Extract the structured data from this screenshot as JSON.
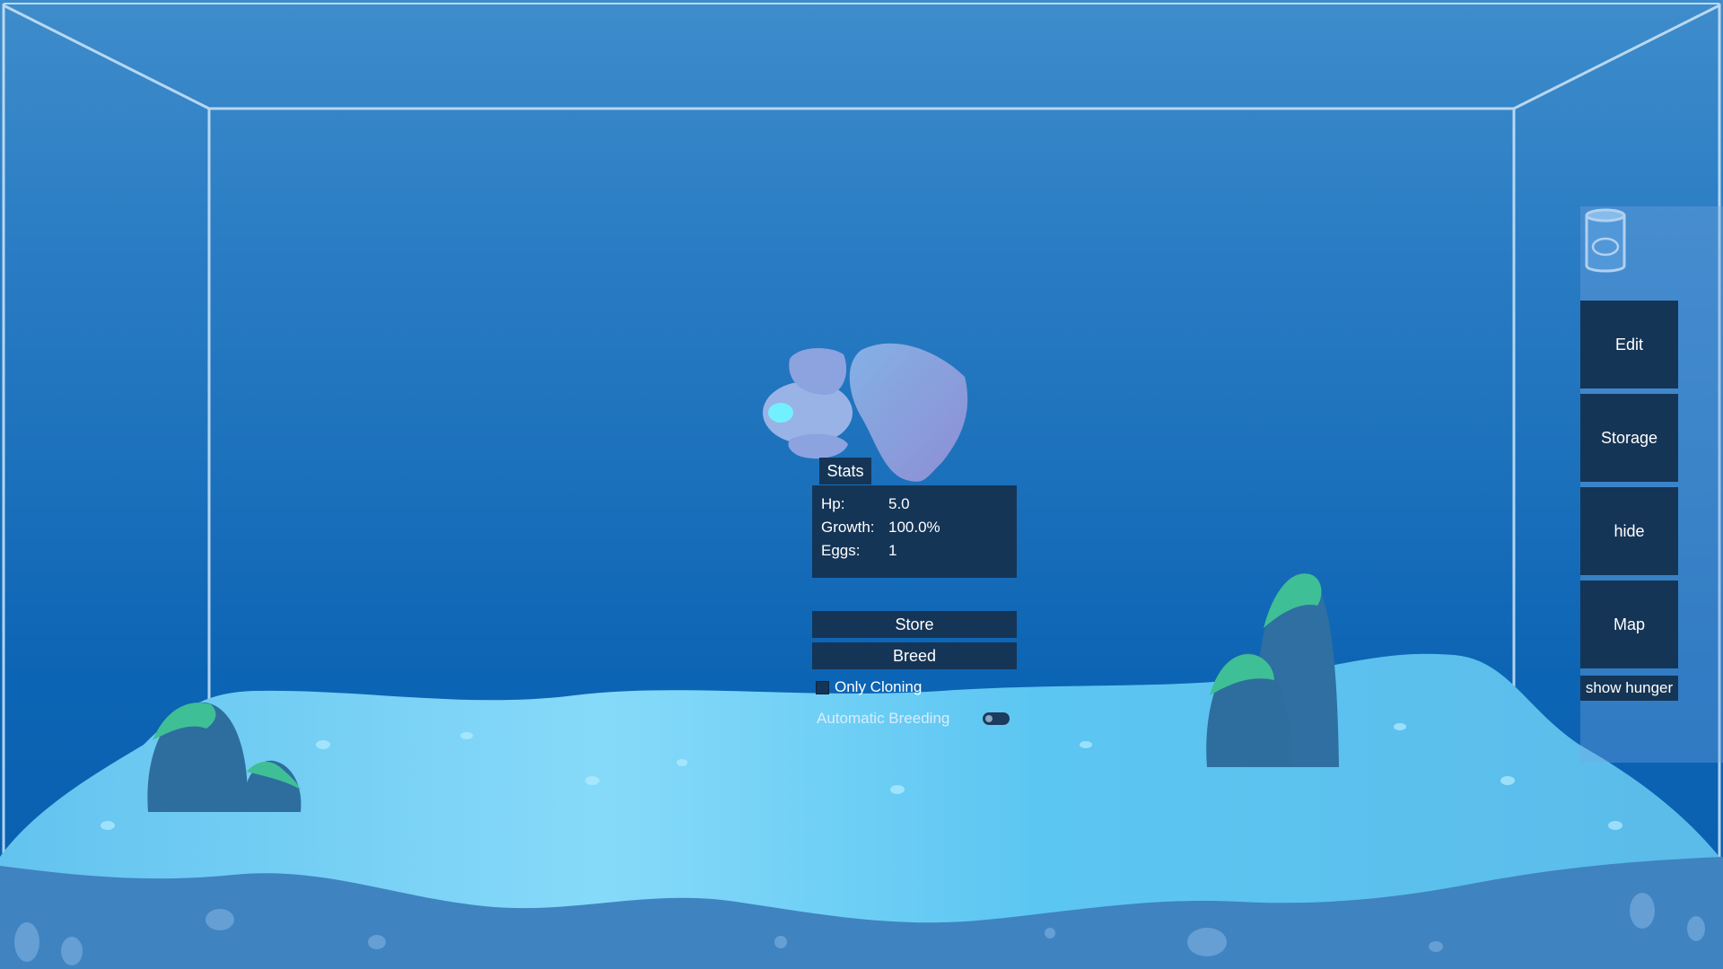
{
  "stats": {
    "tab_label": "Stats",
    "rows": [
      {
        "label": "Hp:",
        "value": "5.0"
      },
      {
        "label": "Growth:",
        "value": "100.0%"
      },
      {
        "label": "Eggs:",
        "value": "1"
      }
    ]
  },
  "actions": {
    "store_label": "Store",
    "breed_label": "Breed",
    "only_cloning_label": "Only Cloning",
    "only_cloning_checked": false,
    "auto_breeding_label": "Automatic Breeding",
    "auto_breeding_on": false
  },
  "sidebar": {
    "jar_icon": "jar-icon",
    "edit_label": "Edit",
    "storage_label": "Storage",
    "hide_label": "hide",
    "map_label": "Map",
    "show_hunger_label": "show hunger"
  },
  "colors": {
    "panel": "#153556",
    "water_top": "#3e8ccb",
    "water_bottom": "#0a5fae",
    "sand": "#6fd0f5",
    "rock": "#2d6e9e",
    "moss": "#3fbf95"
  }
}
